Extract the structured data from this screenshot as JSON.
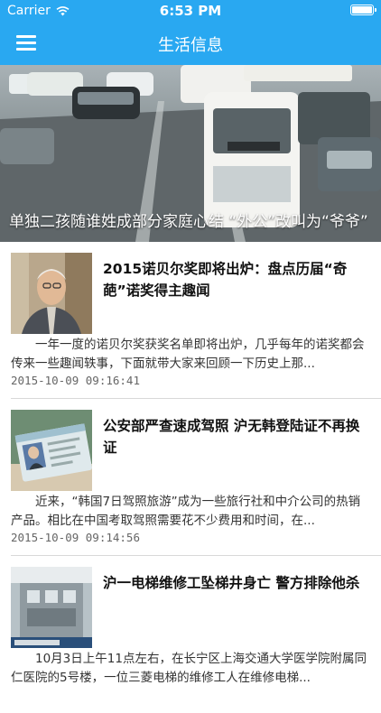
{
  "status_bar": {
    "carrier": "Carrier",
    "time": "6:53 PM"
  },
  "nav": {
    "title": "生活信息"
  },
  "hero": {
    "caption": "单独二孩随谁姓成部分家庭心结 “外公”改叫为“爷爷”"
  },
  "news": [
    {
      "title": "2015诺贝尔奖即将出炉：盘点历届“奇葩”诺奖得主趣闻",
      "summary": "一年一度的诺贝尔奖获奖名单即将出炉，几乎每年的诺奖都会传来一些趣闻轶事，下面就带大家来回顾一下历史上那...",
      "date": "2015-10-09 09:16:41"
    },
    {
      "title": "公安部严查速成驾照 沪无韩登陆证不再换证",
      "summary": "近来，“韩国7日驾照旅游”成为一些旅行社和中介公司的热销产品。相比在中国考取驾照需要花不少费用和时间，在...",
      "date": "2015-10-09 09:14:56"
    },
    {
      "title": "沪一电梯维修工坠梯井身亡 警方排除他杀",
      "summary": "10月3日上午11点左右，在长宁区上海交通大学医学院附属同仁医院的5号楼，一位三菱电梯的维修工人在维修电梯...",
      "date": ""
    }
  ],
  "colors": {
    "nav_bg": "#29a8f1",
    "nav_text": "#ffffff"
  },
  "icons": {
    "menu": "hamburger-menu-icon",
    "wifi": "wifi-icon",
    "battery": "battery-icon"
  }
}
